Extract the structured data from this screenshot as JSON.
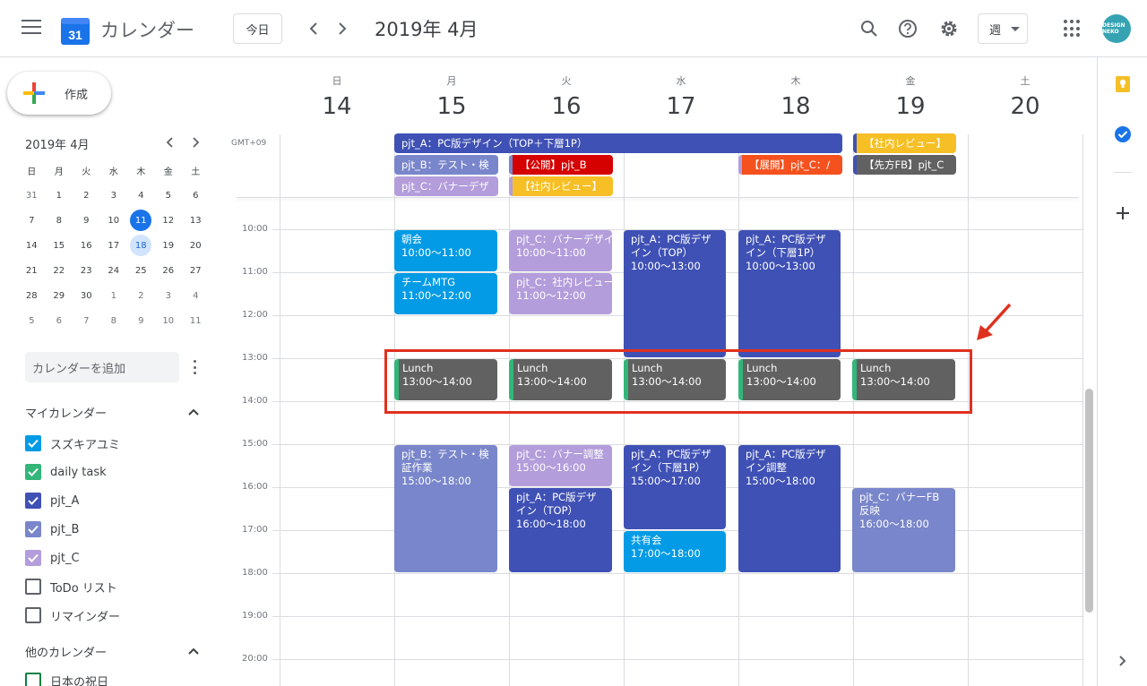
{
  "header": {
    "app_title": "カレンダー",
    "logo_day": "31",
    "today_label": "今日",
    "month_title": "2019年 4月",
    "view_label": "週",
    "avatar_text": "DESIGN NEKO"
  },
  "sidebar": {
    "create_label": "作成",
    "mini_title": "2019年 4月",
    "weekdays": [
      "日",
      "月",
      "火",
      "水",
      "木",
      "金",
      "土"
    ],
    "weeks": [
      [
        "31",
        "1",
        "2",
        "3",
        "4",
        "5",
        "6"
      ],
      [
        "7",
        "8",
        "9",
        "10",
        "11",
        "12",
        "13"
      ],
      [
        "14",
        "15",
        "16",
        "17",
        "18",
        "19",
        "20"
      ],
      [
        "21",
        "22",
        "23",
        "24",
        "25",
        "26",
        "27"
      ],
      [
        "28",
        "29",
        "30",
        "1",
        "2",
        "3",
        "4"
      ],
      [
        "5",
        "6",
        "7",
        "8",
        "9",
        "10",
        "11"
      ]
    ],
    "add_calendar_placeholder": "カレンダーを追加",
    "my_calendars_title": "マイカレンダー",
    "my_calendars": [
      {
        "name": "スズキアユミ",
        "color": "#039be5",
        "checked": true
      },
      {
        "name": "daily task",
        "color": "#33b679",
        "checked": true
      },
      {
        "name": "pjt_A",
        "color": "#3f51b5",
        "checked": true
      },
      {
        "name": "pjt_B",
        "color": "#7986cb",
        "checked": true
      },
      {
        "name": "pjt_C",
        "color": "#b39ddb",
        "checked": true
      },
      {
        "name": "ToDo リスト",
        "color": "#5f6368",
        "checked": false
      },
      {
        "name": "リマインダー",
        "color": "#5f6368",
        "checked": false
      }
    ],
    "other_calendars_title": "他のカレンダー",
    "other_calendars": [
      {
        "name": "日本の祝日",
        "color": "#0b8043",
        "checked": false
      }
    ]
  },
  "week": {
    "timezone": "GMT+09",
    "days": [
      {
        "dow": "日",
        "num": "14"
      },
      {
        "dow": "月",
        "num": "15"
      },
      {
        "dow": "火",
        "num": "16"
      },
      {
        "dow": "水",
        "num": "17"
      },
      {
        "dow": "木",
        "num": "18"
      },
      {
        "dow": "金",
        "num": "19"
      },
      {
        "dow": "土",
        "num": "20"
      }
    ],
    "hours": [
      "10:00",
      "11:00",
      "12:00",
      "13:00",
      "14:00",
      "15:00",
      "16:00",
      "17:00",
      "18:00",
      "19:00",
      "20:00"
    ]
  },
  "allday_events": {
    "a1": "pjt_A：PC版デザイン（TOP＋下層1P）",
    "b1": "pjt_B：テスト・検",
    "c1": "pjt_C：バナーデザ",
    "d1": "【公開】pjt_B",
    "d2": "【社内レビュー】",
    "e1": "【展開】pjt_C：/",
    "f1": "【社内レビュー】",
    "f2": "【先方FB】pjt_C"
  },
  "events": {
    "mon_asakai": {
      "title": "朝会",
      "time": "10:00〜11:00"
    },
    "mon_team": {
      "title": "チームMTG",
      "time": "11:00〜12:00"
    },
    "tue_c1": {
      "title": "pjt_C：バナーデザイ",
      "time": "10:00〜11:00"
    },
    "tue_c2": {
      "title": "pjt_C：社内レビュー",
      "time": "11:00〜12:00"
    },
    "wed_a1": {
      "title": "pjt_A：PC版デザイン（TOP）",
      "time": "10:00〜13:00"
    },
    "thu_a1": {
      "title": "pjt_A：PC版デザイン（下層1P）",
      "time": "10:00〜13:00"
    },
    "lunch": {
      "title": "Lunch",
      "time": "13:00〜14:00"
    },
    "mon_b": {
      "title": "pjt_B：テスト・検証作業",
      "time": "15:00〜18:00"
    },
    "tue_c3": {
      "title": "pjt_C：バナー調整",
      "time": "15:00〜16:00"
    },
    "tue_a": {
      "title": "pjt_A：PC版デザイン（TOP）",
      "time": "16:00〜18:00"
    },
    "wed_a2": {
      "title": "pjt_A：PC版デザイン（下層1P）",
      "time": "15:00〜17:00"
    },
    "wed_share": {
      "title": "共有会",
      "time": "17:00〜18:00"
    },
    "thu_a2": {
      "title": "pjt_A：PC版デザイン調整",
      "time": "15:00〜18:00"
    },
    "fri_c": {
      "title": "pjt_C：バナーFB反映",
      "time": "16:00〜18:00"
    }
  },
  "colors": {
    "pjt_a": "#3f51b5",
    "pjt_b": "#7986cb",
    "pjt_c": "#b39ddb",
    "personal": "#039be5",
    "lunch": "#616161",
    "daily_task": "#33b679",
    "red_event": "#d50000",
    "orange_event": "#f4511e",
    "yellow_event": "#f6bf26",
    "dark_event": "#616161",
    "highlight": "#e0301e"
  }
}
